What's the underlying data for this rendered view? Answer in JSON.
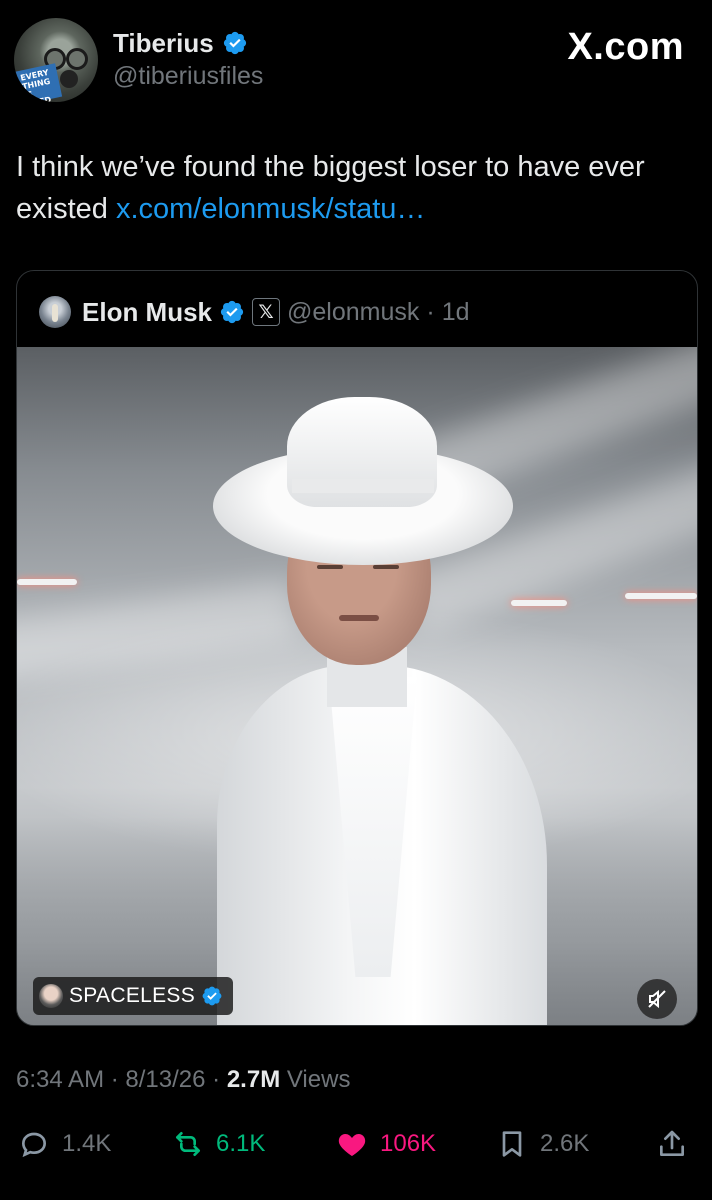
{
  "author": {
    "display_name": "Tiberius",
    "handle": "@tiberiusfiles",
    "avatar_badge_text": "EVERY THING IS FILED"
  },
  "brand": {
    "site": "X.com"
  },
  "tweet": {
    "text": "I think we’ve found the biggest loser to have ever existed ",
    "link_text": "x.com/elonmusk/statu…"
  },
  "quoted_post": {
    "display_name": "Elon Musk",
    "affiliation_badge": "𝕏",
    "handle": "@elonmusk",
    "separator": "·",
    "time_ago": "1d",
    "media": {
      "channel_name": "SPACELESS"
    }
  },
  "meta": {
    "time": "6:34 AM",
    "sep1": "·",
    "date": "8/13/26",
    "sep2": "·",
    "views_count": "2.7M",
    "views_label": "Views"
  },
  "actions": {
    "replies": "1.4K",
    "reposts": "6.1K",
    "likes": "106K",
    "bookmarks": "2.6K"
  },
  "colors": {
    "background": "#000000",
    "link": "#1d9bf0",
    "repost": "#00ba7c",
    "like": "#f91880",
    "verified": "#1d9bf0",
    "muted_text": "#71767b"
  }
}
